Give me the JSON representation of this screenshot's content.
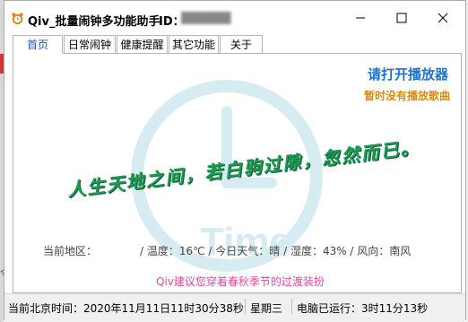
{
  "window": {
    "title": "Qiv_批量闹钟多功能助手",
    "id_label": "ID：",
    "id_value": "██████"
  },
  "tabs": [
    {
      "label": "首页",
      "active": true
    },
    {
      "label": "日常闹钟",
      "active": false
    },
    {
      "label": "健康提醒",
      "active": false
    },
    {
      "label": "其它功能",
      "active": false
    },
    {
      "label": "关于",
      "active": false
    }
  ],
  "home": {
    "player_link": "请打开播放器",
    "no_song": "暂时没有播放歌曲",
    "quote": "人生天地之间，若白驹过隙，忽然而已。",
    "weather_region": "当前地区：",
    "weather_detail": "/ 温度：16℃ / 今日天气：晴 / 湿度：43% / 风向：南风",
    "tip": "Qiv建议您穿着春秋季节的过渡装扮",
    "watermark_text": "Time"
  },
  "status": {
    "beijing_time": "当前北京时间：2020年11月11日11时30分38秒",
    "weekday": "星期三",
    "uptime": "电脑已运行：3时11分13秒"
  },
  "colors": {
    "accent_blue": "#1d72c9",
    "orange": "#e08a00",
    "quote_green": "#1e9c55",
    "tip_pink": "#e14a9c",
    "watermark": "#d7ecf2"
  },
  "icons": [
    "alarm-clock-icon",
    "minimize-icon",
    "maximize-icon",
    "close-icon",
    "clock-watermark-icon"
  ]
}
